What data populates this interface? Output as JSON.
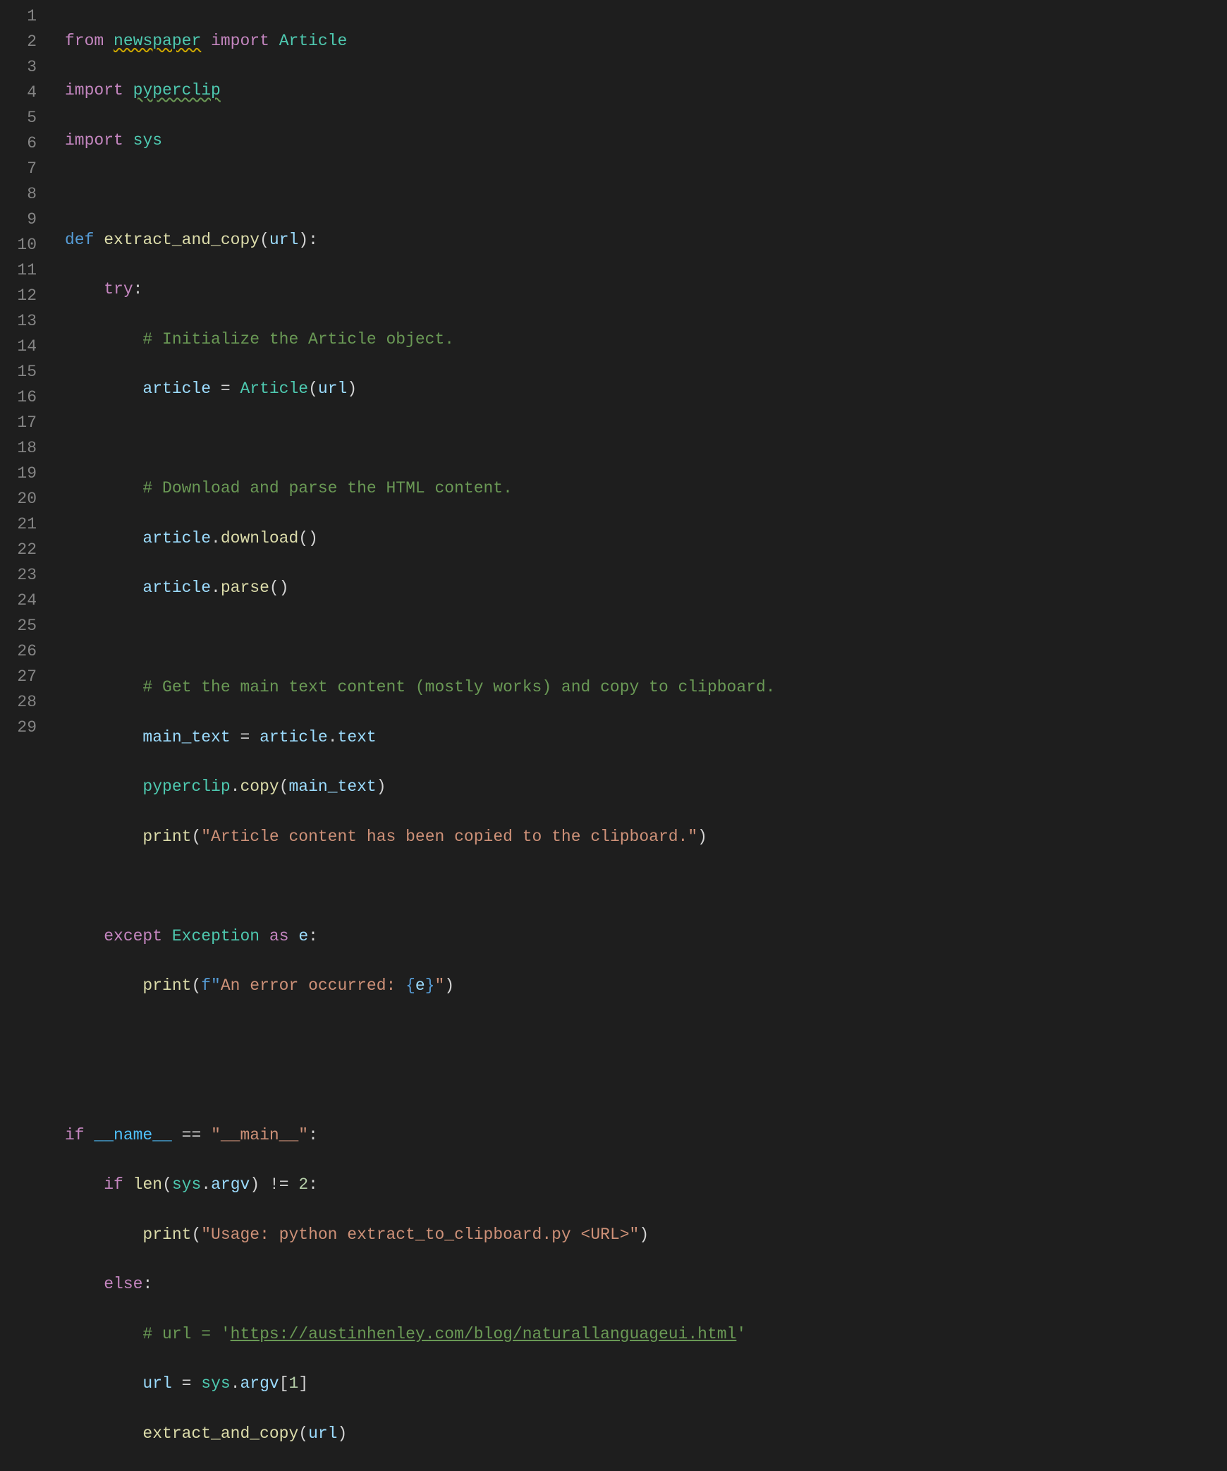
{
  "lineNumbers": [
    "1",
    "2",
    "3",
    "4",
    "5",
    "6",
    "7",
    "8",
    "9",
    "10",
    "11",
    "12",
    "13",
    "14",
    "15",
    "16",
    "17",
    "18",
    "19",
    "20",
    "21",
    "22",
    "23",
    "24",
    "25",
    "26",
    "27",
    "28",
    "29"
  ],
  "tokens": {
    "l1": {
      "from": "from",
      "newspaper": "newspaper",
      "import": "import",
      "Article": "Article"
    },
    "l2": {
      "import": "import",
      "pyperclip": "pyperclip"
    },
    "l3": {
      "import": "import",
      "sys": "sys"
    },
    "l5": {
      "def": "def",
      "name": "extract_and_copy",
      "lp": "(",
      "param": "url",
      "rp": ")",
      "colon": ":"
    },
    "l6": {
      "try": "try",
      "colon": ":"
    },
    "l7": {
      "cmt": "# Initialize the Article object."
    },
    "l8": {
      "article": "article",
      "eq": " = ",
      "Article": "Article",
      "lp": "(",
      "url": "url",
      "rp": ")"
    },
    "l10": {
      "cmt": "# Download and parse the HTML content."
    },
    "l11": {
      "article": "article",
      "dot": ".",
      "download": "download",
      "lp": "(",
      "rp": ")"
    },
    "l12": {
      "article": "article",
      "dot": ".",
      "parse": "parse",
      "lp": "(",
      "rp": ")"
    },
    "l14": {
      "cmt": "# Get the main text content (mostly works) and copy to clipboard."
    },
    "l15": {
      "main_text": "main_text",
      "eq": " = ",
      "article": "article",
      "dot": ".",
      "text": "text"
    },
    "l16": {
      "pyperclip": "pyperclip",
      "dot": ".",
      "copy": "copy",
      "lp": "(",
      "main_text": "main_text",
      "rp": ")"
    },
    "l17": {
      "print": "print",
      "lp": "(",
      "str": "\"Article content has been copied to the clipboard.\"",
      "rp": ")"
    },
    "l19": {
      "except": "except",
      "Exception": "Exception",
      "as": "as",
      "e": "e",
      "colon": ":"
    },
    "l20": {
      "print": "print",
      "lp": "(",
      "f": "f\"",
      "s1": "An error occurred: ",
      "lb": "{",
      "e": "e",
      "rb": "}",
      "q": "\"",
      "rp": ")"
    },
    "l23": {
      "if": "if",
      "name": "__name__",
      "eq": " == ",
      "main": "\"__main__\"",
      "colon": ":"
    },
    "l24": {
      "if": "if",
      "len": "len",
      "lp": "(",
      "sys": "sys",
      "dot": ".",
      "argv": "argv",
      "rp": ")",
      "neq": " != ",
      "two": "2",
      "colon": ":"
    },
    "l25": {
      "print": "print",
      "lp": "(",
      "str": "\"Usage: python extract_to_clipboard.py <URL>\"",
      "rp": ")"
    },
    "l26": {
      "else": "else",
      "colon": ":"
    },
    "l27": {
      "c1": "# url = '",
      "url": "https://austinhenley.com/blog/naturallanguageui.html",
      "c2": "'"
    },
    "l28": {
      "url": "url",
      "eq": " = ",
      "sys": "sys",
      "dot": ".",
      "argv": "argv",
      "lb": "[",
      "one": "1",
      "rb": "]"
    },
    "l29": {
      "fn": "extract_and_copy",
      "lp": "(",
      "url": "url",
      "rp": ")"
    }
  },
  "indent": {
    "i1": "    ",
    "i2": "        ",
    "i3": "            "
  }
}
